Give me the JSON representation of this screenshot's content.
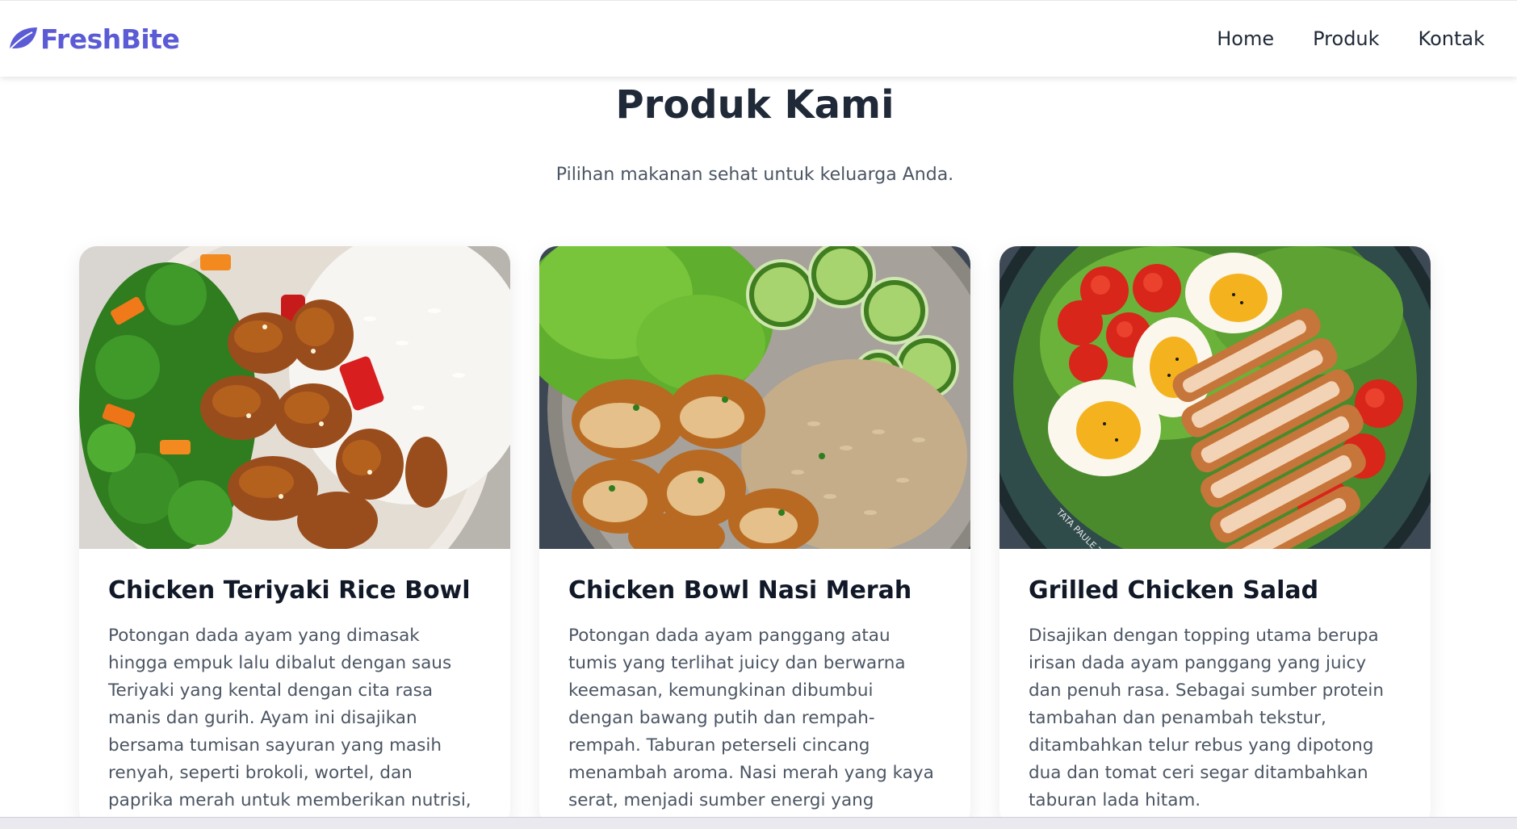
{
  "nav": {
    "brand": "FreshBite",
    "links": [
      "Home",
      "Produk",
      "Kontak"
    ]
  },
  "hero": {
    "title": "Produk Kami",
    "subtitle": "Pilihan makanan sehat untuk keluarga Anda."
  },
  "products": [
    {
      "title": "Chicken Teriyaki Rice Bowl",
      "description": "Potongan dada ayam yang dimasak hingga empuk lalu dibalut dengan saus Teriyaki yang kental dengan cita rasa manis dan gurih. Ayam ini disajikan bersama tumisan sayuran yang masih renyah, seperti brokoli, wortel, dan paprika merah untuk memberikan nutrisi, warna, dan tekstur."
    },
    {
      "title": "Chicken Bowl Nasi Merah",
      "description": "Potongan dada ayam panggang atau tumis yang terlihat juicy dan berwarna keemasan, kemungkinan dibumbui dengan bawang putih dan rempah-rempah. Taburan peterseli cincang menambah aroma. Nasi merah yang kaya serat, menjadi sumber energi yang dilepaskan secara perlahan."
    },
    {
      "title": "Grilled Chicken Salad",
      "description": "Disajikan dengan topping utama berupa irisan dada ayam panggang yang juicy dan penuh rasa. Sebagai sumber protein tambahan dan penambah tekstur, ditambahkan telur rebus yang dipotong dua dan tomat ceri segar ditambahkan taburan lada hitam."
    }
  ],
  "image_watermark": "TATA PAULE T",
  "colors": {
    "brand": "#5b5bd6",
    "text": "#1f2937",
    "muted": "#4b5563"
  }
}
